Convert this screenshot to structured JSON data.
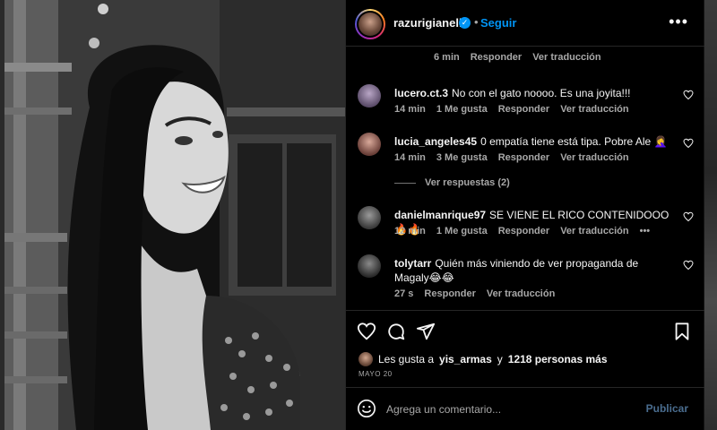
{
  "header": {
    "username": "razurigianella",
    "verified_icon": "verified-badge-icon",
    "separator": "•",
    "follow_label": "Seguir",
    "more_label": "•••"
  },
  "top_meta": {
    "time": "6 min",
    "reply": "Responder",
    "translate": "Ver traducción"
  },
  "comments": [
    {
      "user": "lucero.ct.3",
      "text": "No con el gato noooo. Es una joyita!!!",
      "time": "14 min",
      "likes": "1 Me gusta",
      "reply": "Responder",
      "translate": "Ver traducción",
      "avatar_color": "#7a6a8a"
    },
    {
      "user": "lucia_angeles45",
      "text": "0 empatía tiene está tipa. Pobre Ale 🤦‍♀️",
      "time": "14 min",
      "likes": "3 Me gusta",
      "reply": "Responder",
      "translate": "Ver traducción",
      "avatar_color": "#8a5a55"
    },
    {
      "user": "danielmanrique97",
      "text": "SE VIENE EL RICO CONTENIDOOO 🔥🔥",
      "time": "12 min",
      "likes": "1 Me gusta",
      "reply": "Responder",
      "translate": "Ver traducción",
      "extra": "•••",
      "avatar_color": "#6a6a6a"
    },
    {
      "user": "tolytarr",
      "text": "Quién más viniendo de ver propaganda de Magaly😂😂",
      "time": "27 s",
      "reply": "Responder",
      "translate": "Ver traducción",
      "avatar_color": "#4a4a4a"
    }
  ],
  "replies_link": "Ver respuestas (2)",
  "likes": {
    "prefix": "Les gusta a",
    "user": "yis_armas",
    "connector": "y",
    "count": "1218 personas más"
  },
  "date": "MAYO 20",
  "composer": {
    "placeholder": "Agrega un comentario...",
    "publish_label": "Publicar"
  },
  "colors": {
    "accent": "#0095f6",
    "background": "#000000",
    "muted": "#a8a8a8"
  }
}
